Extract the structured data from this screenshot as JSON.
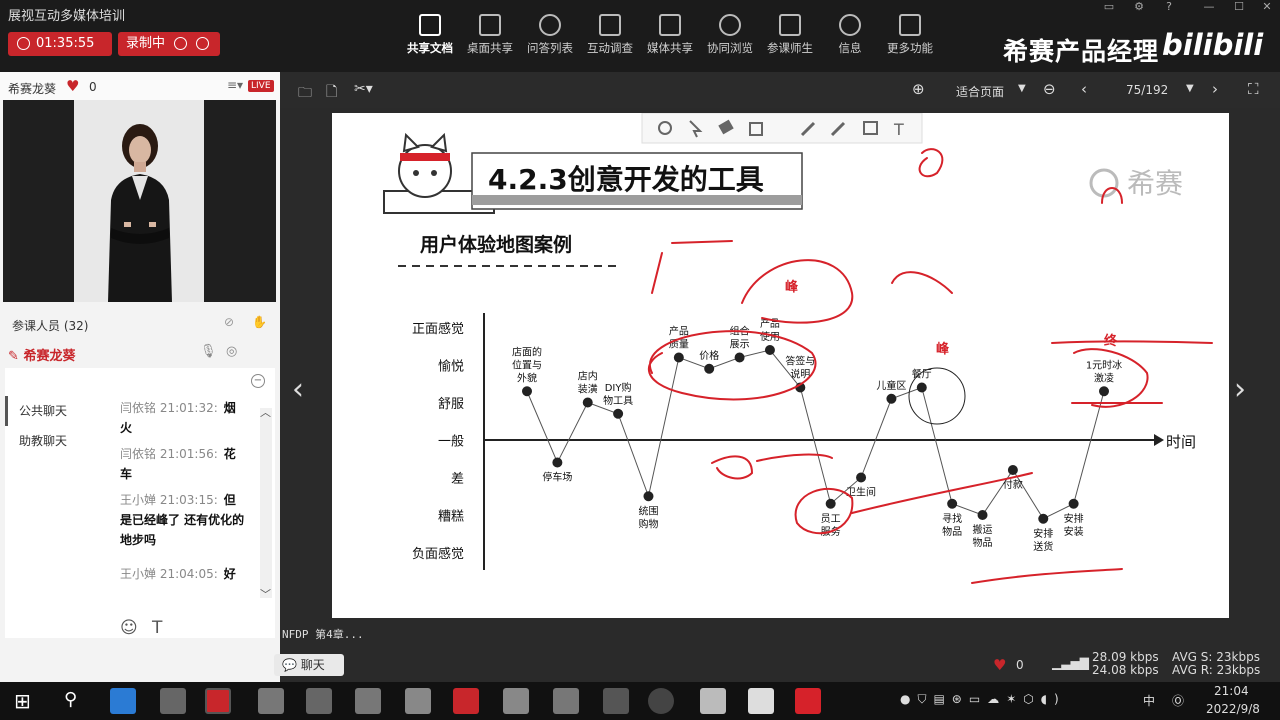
{
  "app": {
    "title": "展视互动多媒体培训",
    "timer": "01:35:55",
    "recording_label": "录制中",
    "brand_text": "希赛产品经理",
    "brand_logo": "bilibili"
  },
  "toolbar": [
    {
      "label": "共享文档",
      "icon": "document-icon",
      "active": true
    },
    {
      "label": "桌面共享",
      "icon": "desktop-share-icon"
    },
    {
      "label": "问答列表",
      "icon": "qa-icon"
    },
    {
      "label": "互动调查",
      "icon": "survey-chart-icon"
    },
    {
      "label": "媒体共享",
      "icon": "film-icon"
    },
    {
      "label": "协同浏览",
      "icon": "compass-icon"
    },
    {
      "label": "参课师生",
      "icon": "people-icon"
    },
    {
      "label": "信息",
      "icon": "info-icon"
    },
    {
      "label": "更多功能",
      "icon": "more-icon"
    }
  ],
  "video": {
    "host_name": "希赛龙葵",
    "likes": "0",
    "live_badge": "LIVE"
  },
  "participants": {
    "label": "参课人员 (32)",
    "host": "希赛龙葵"
  },
  "chat": {
    "tabs": [
      "公共聊天",
      "助教聊天"
    ],
    "messages": [
      {
        "meta": "闫依铭 21:01:32:",
        "tail": "烟",
        "body": "火"
      },
      {
        "meta": "闫依铭 21:01:56:",
        "tail": "花",
        "body": "车"
      },
      {
        "meta": "王小婵 21:03:15:",
        "tail": "但",
        "body": "是已经峰了  还有优化的地步吗"
      },
      {
        "meta": "王小婵 21:04:05:",
        "tail": "好",
        "body": ""
      }
    ],
    "chat_button": "聊天"
  },
  "viewer": {
    "zoom_mode": "适合页面",
    "page": "75/192",
    "file_label": "NFDP 第4章..."
  },
  "slide": {
    "section_title": "4.2.3创意开发的工具",
    "subtitle": "用户体验地图案例",
    "logo_text": "希赛",
    "y_levels": [
      "正面感觉",
      "愉悦",
      "舒服",
      "一般",
      "差",
      "糟糕",
      "负面感觉"
    ],
    "x_axis_label": "时间",
    "points": [
      {
        "label": "店面的\n位置与\n外貌",
        "level": 1.3
      },
      {
        "label": "停车场",
        "level": -0.6
      },
      {
        "label": "店内\n装潢",
        "level": 1.0
      },
      {
        "label": "DIY购\n物工具",
        "level": 0.7
      },
      {
        "label": "统围\n购物",
        "level": -1.5
      },
      {
        "label": "产品\n质量",
        "level": 2.2
      },
      {
        "label": "价格",
        "level": 1.9
      },
      {
        "label": "组合\n展示",
        "level": 2.2
      },
      {
        "label": "产品\n使用",
        "level": 2.4
      },
      {
        "label": "答签与\n说明",
        "level": 1.4
      },
      {
        "label": "员工\n服务",
        "level": -1.7
      },
      {
        "label": "卫生间",
        "level": -1.0
      },
      {
        "label": "儿童区",
        "level": 1.1
      },
      {
        "label": "餐厅",
        "level": 1.4
      },
      {
        "label": "寻找\n物品",
        "level": -1.7
      },
      {
        "label": "搬运\n物品",
        "level": -2.0
      },
      {
        "label": "付款",
        "level": -0.8
      },
      {
        "label": "安排\n送货",
        "level": -2.1
      },
      {
        "label": "安排\n安装",
        "level": -1.7
      },
      {
        "label": "1元时冰\n激凌",
        "level": 1.3
      }
    ],
    "annotations": [
      "峰",
      "峰",
      "终"
    ]
  },
  "stats": {
    "likes": "0",
    "up_rate": "28.09 kbps",
    "down_rate": "24.08 kbps",
    "avg_s": "AVG S: 23kbps",
    "avg_r": "AVG R: 23kbps"
  },
  "taskbar": {
    "ime": "中",
    "time": "21:04",
    "date": "2022/9/8"
  },
  "colors": {
    "record_red": "#c8262b",
    "pen_red": "#d6222a",
    "topbar_bg": "#1b1b1b"
  }
}
